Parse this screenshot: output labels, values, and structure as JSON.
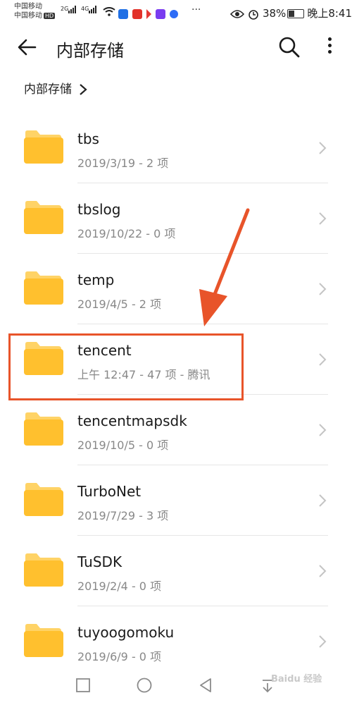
{
  "status_bar": {
    "carrier_1": "中国移动",
    "carrier_2": "中国移动",
    "hd_badge": "HD",
    "net_1": "2G",
    "net_2": "4G",
    "overflow": "···",
    "battery_percent": "38%",
    "time": "晚上8:41"
  },
  "app_bar": {
    "title": "内部存储"
  },
  "breadcrumb": {
    "label": "内部存储"
  },
  "folders": [
    {
      "name": "tbs",
      "meta": "2019/3/19 - 2 项"
    },
    {
      "name": "tbslog",
      "meta": "2019/10/22 - 0 项"
    },
    {
      "name": "temp",
      "meta": "2019/4/5 - 2 项"
    },
    {
      "name": "tencent",
      "meta": "上午 12:47 - 47 项 - 腾讯",
      "highlighted": true
    },
    {
      "name": "tencentmapsdk",
      "meta": "2019/10/5 - 0 项"
    },
    {
      "name": "TurboNet",
      "meta": "2019/7/29 - 3 项"
    },
    {
      "name": "TuSDK",
      "meta": "2019/2/4 - 0 项"
    },
    {
      "name": "tuyoogomoku",
      "meta": "2019/6/9 - 0 项"
    }
  ],
  "colors": {
    "folder": "#FFC02E",
    "folder_tab": "#FFD366",
    "annotation": "#E8542A"
  },
  "watermark": "Baidu 经验"
}
